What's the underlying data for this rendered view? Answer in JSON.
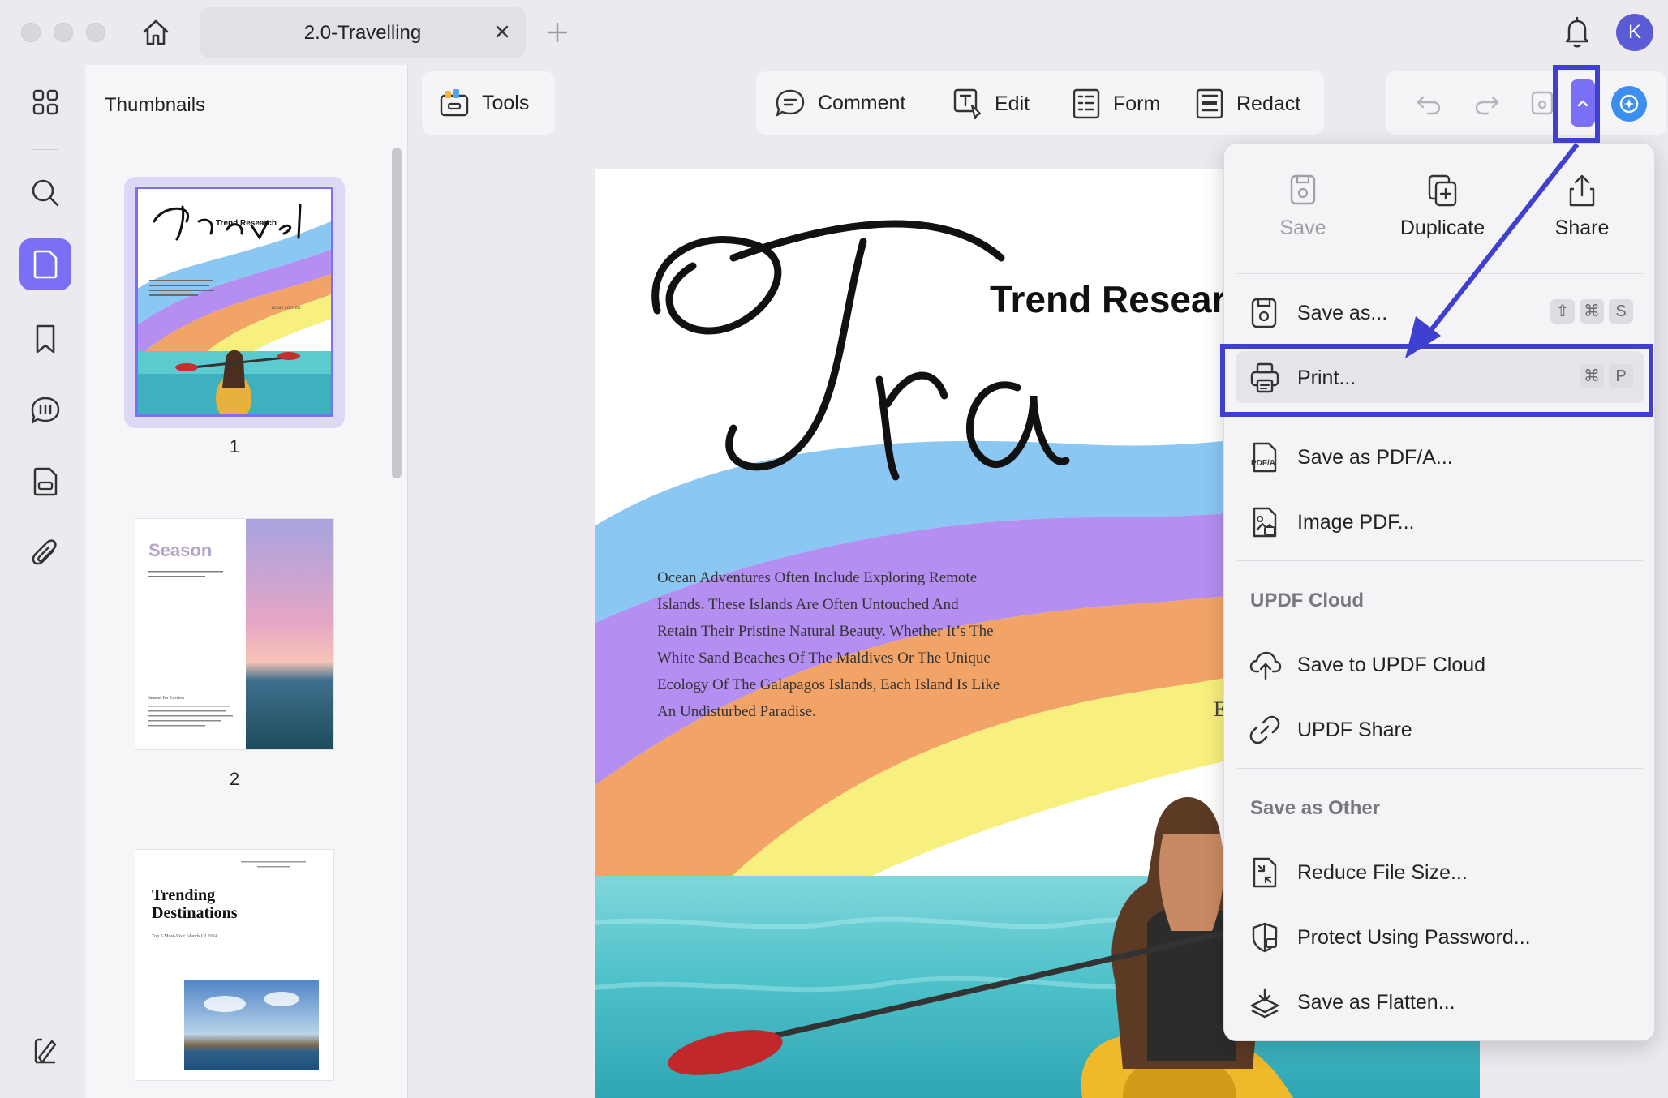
{
  "window": {
    "tab_title": "2.0-Travelling",
    "avatar_letter": "K"
  },
  "sidebar": {
    "panel_title": "Thumbnails",
    "items": [
      {
        "icon": "grid-icon"
      },
      {
        "icon": "search-icon"
      },
      {
        "icon": "page-icon"
      },
      {
        "icon": "bookmark-icon"
      },
      {
        "icon": "comment-list-icon"
      },
      {
        "icon": "form-fields-icon"
      },
      {
        "icon": "attachment-icon"
      },
      {
        "icon": "sign-icon"
      }
    ],
    "thumbnails": [
      {
        "page": "1",
        "heading": "Travel",
        "sub": "Trend Research",
        "author": "ROSIE COOPER"
      },
      {
        "page": "2",
        "heading": "Season",
        "sub": "Seasons For Travelers"
      },
      {
        "page": "",
        "heading": "Trending Destinations",
        "sub": "Top 5 Must-Visit Islands Of 2024"
      }
    ]
  },
  "toolbar": {
    "tools_label": "Tools",
    "comment_label": "Comment",
    "edit_label": "Edit",
    "form_label": "Form",
    "redact_label": "Redact"
  },
  "document": {
    "script_title": "Travel",
    "subtitle": "Trend Research",
    "body": [
      "Ocean Adventures Often Include Exploring Remote",
      "Islands. These Islands Are Often Untouched And",
      "Retain Their Pristine Natural Beauty. Whether It’s The",
      "White Sand Beaches Of The Maldives Or The Unique",
      "Ecology Of The Galapagos Islands, Each Island Is Like",
      "An Undisturbed Paradise."
    ],
    "author_initial": "E"
  },
  "menu": {
    "quick_actions": {
      "save": "Save",
      "duplicate": "Duplicate",
      "share": "Share"
    },
    "save_as": {
      "label": "Save as...",
      "keys": [
        "⇧",
        "⌘",
        "S"
      ]
    },
    "print": {
      "label": "Print...",
      "keys": [
        "⌘",
        "P"
      ]
    },
    "save_pdfa": "Save as PDF/A...",
    "image_pdf": "Image PDF...",
    "cloud_section": "UPDF Cloud",
    "save_cloud": "Save to UPDF Cloud",
    "updf_share": "UPDF Share",
    "other_section": "Save as Other",
    "reduce": "Reduce File Size...",
    "protect": "Protect Using Password...",
    "flatten": "Save as Flatten..."
  },
  "colors": {
    "accent": "#7b6ff5",
    "annotation": "#3f3fd0",
    "rainbow_blue": "#8ac8f3",
    "rainbow_purple": "#b48ef0",
    "rainbow_orange": "#f2a468",
    "rainbow_yellow": "#f7f07e"
  }
}
